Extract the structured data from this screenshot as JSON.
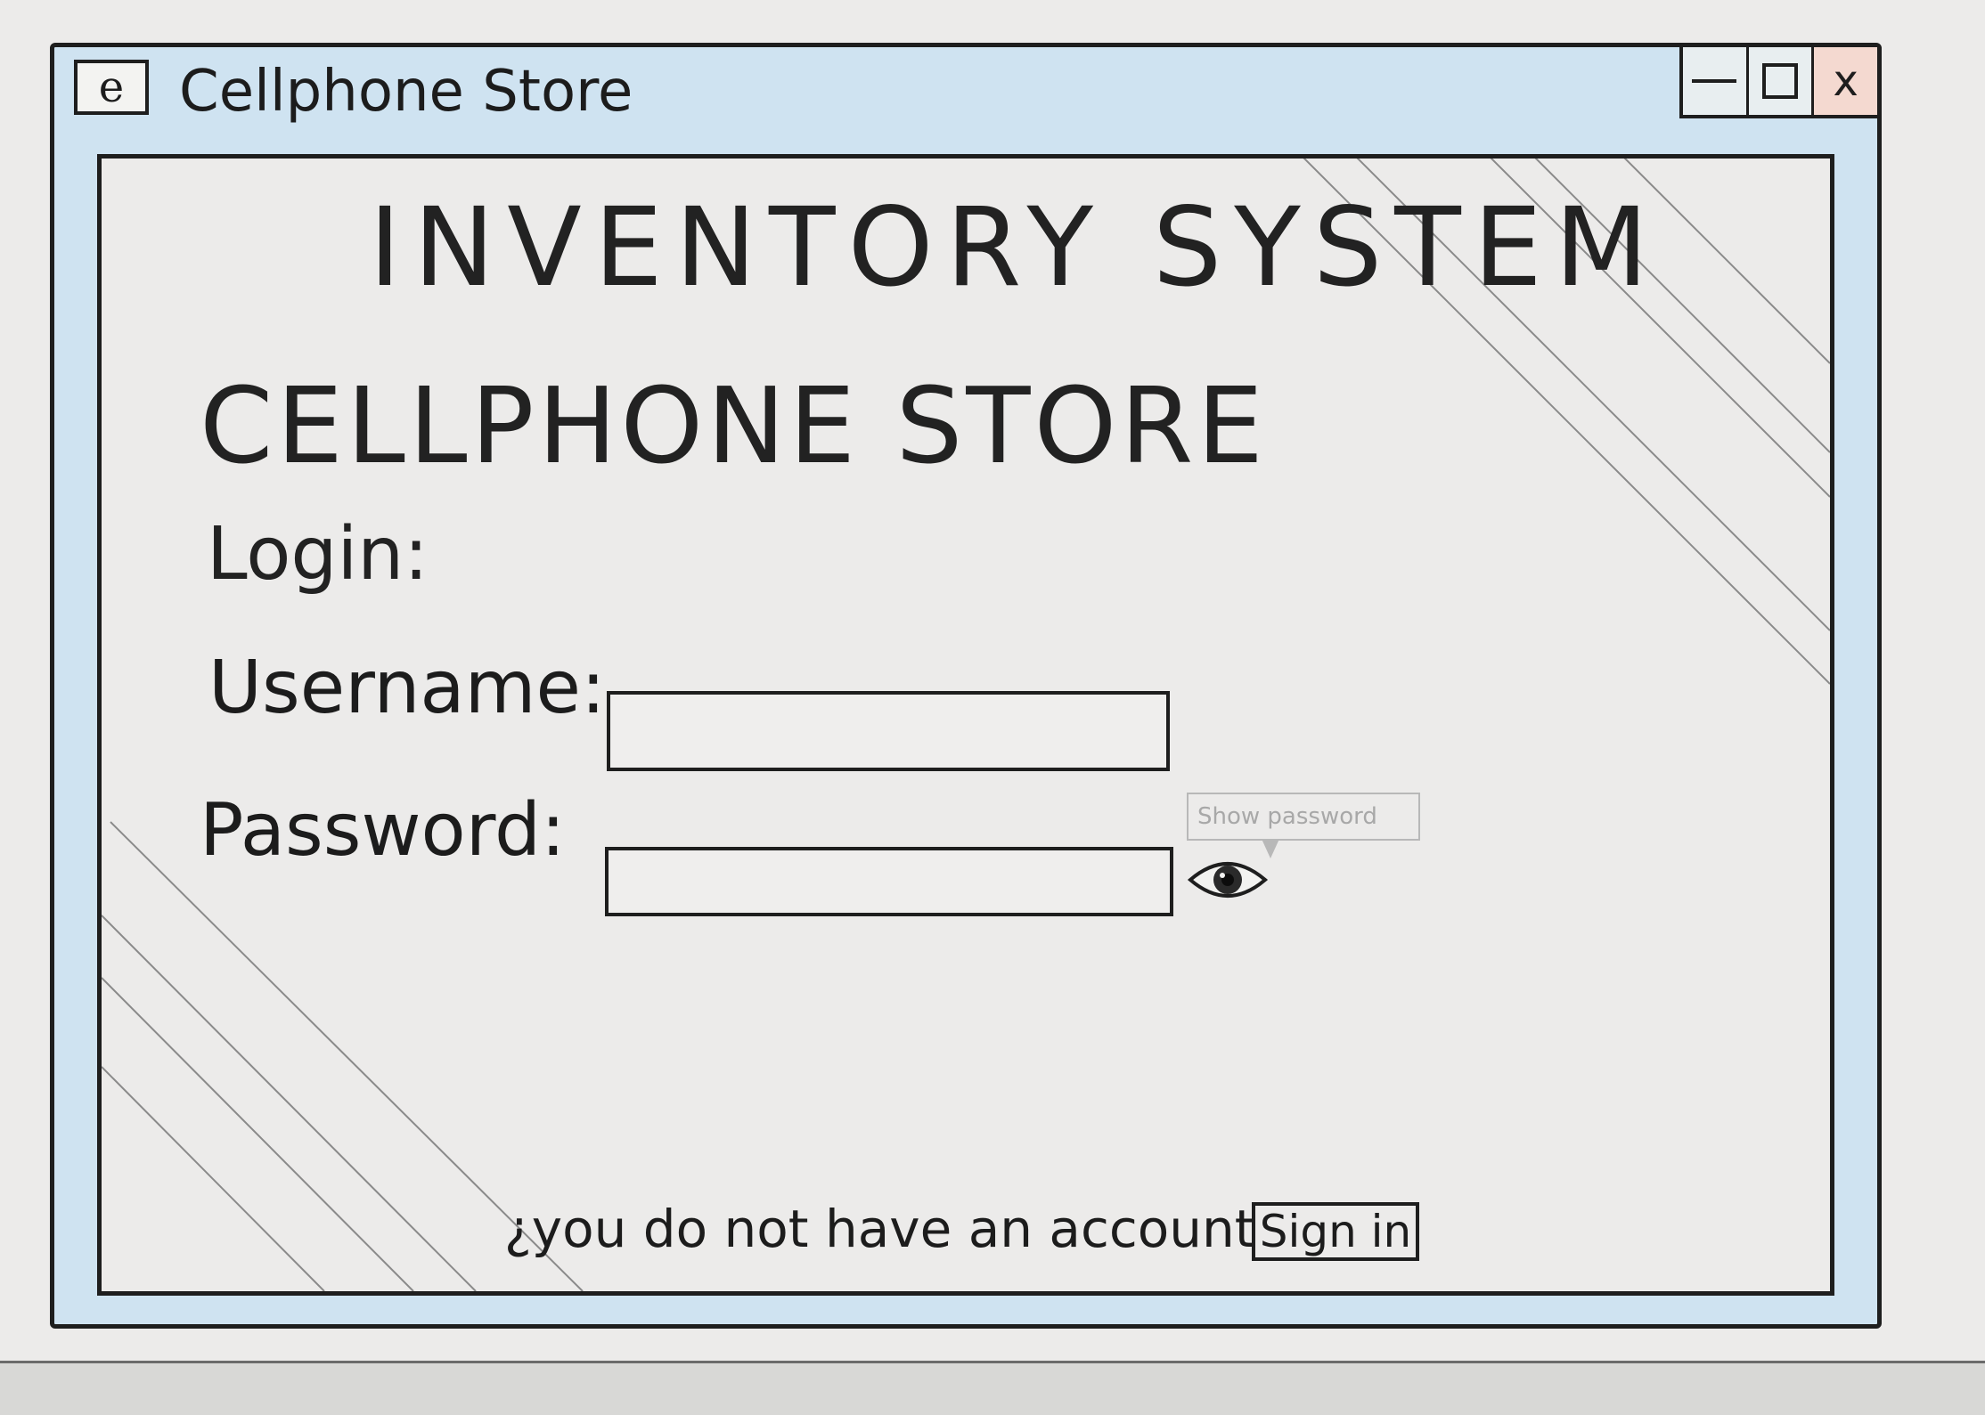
{
  "window": {
    "title": "Cellphone Store",
    "app_icon": "e",
    "controls": {
      "minimize": "minimize-icon",
      "maximize": "maximize-icon",
      "close_label": "x"
    }
  },
  "main": {
    "system_title": "INVENTORY SYSTEM",
    "store_title": "CELLPHONE STORE",
    "login_label": "Login:",
    "username_label": "Username:",
    "username_value": "",
    "password_label": "Password:",
    "password_value": "",
    "show_password_tooltip": "Show password",
    "no_account_text": "¿you do not have an account?",
    "signin_label": "Sign in"
  },
  "colors": {
    "window_frame": "#cfe3f1",
    "close_button": "#f4d9d0",
    "ink": "#1e1e1e",
    "paper": "#ecebea"
  }
}
